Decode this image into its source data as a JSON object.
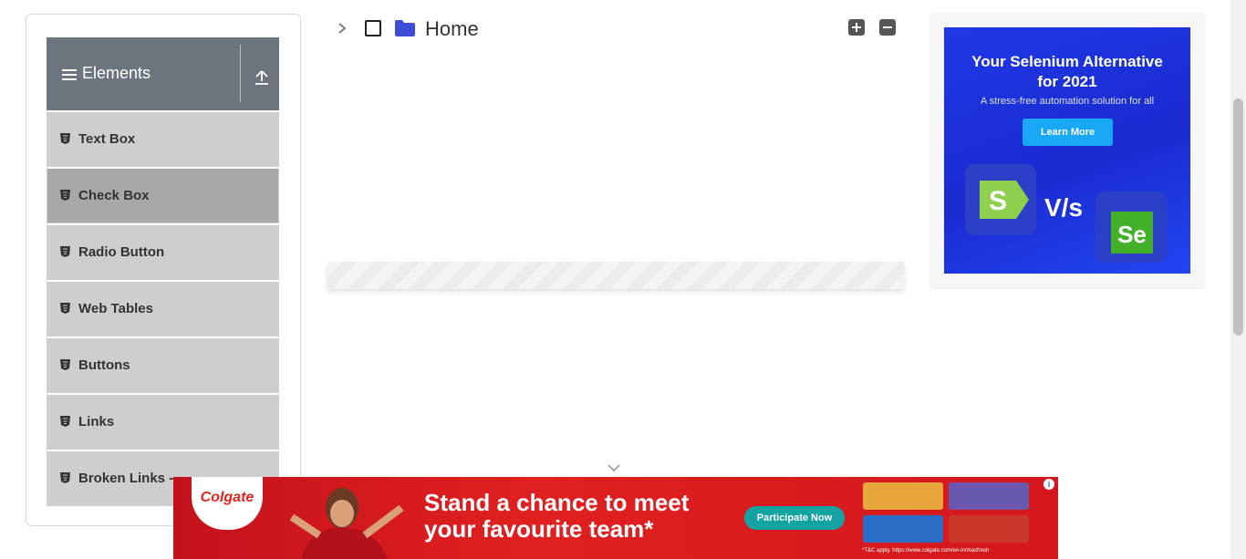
{
  "sidebar": {
    "group_title": "Elements",
    "items": [
      {
        "label": "Text Box"
      },
      {
        "label": "Check Box"
      },
      {
        "label": "Radio Button"
      },
      {
        "label": "Web Tables"
      },
      {
        "label": "Buttons"
      },
      {
        "label": "Links"
      },
      {
        "label": "Broken Links -"
      }
    ],
    "active_item": "Check Box"
  },
  "tree": {
    "root_label": "Home",
    "checked": false,
    "expanded": false
  },
  "right_ad": {
    "headline_line1": "Your Selenium Alternative",
    "headline_line2": "for 2021",
    "subtext": "A stress-free automation solution for all",
    "cta": "Learn More",
    "vs_text": "V/s",
    "logo_right": "Se",
    "logo_left": "S"
  },
  "bottom_ad": {
    "brand": "Colgate",
    "headline_line1": "Stand a chance to meet",
    "headline_line2": "your favourite team*",
    "cta": "Participate Now",
    "terms": "*T&C apply. https://www.colgate.com/en-in/maxfresh",
    "info_icon": "i"
  },
  "colors": {
    "sidebar_header": "#6c757d",
    "menu_item": "#cecece",
    "menu_item_active": "#a8a8a8",
    "folder": "#3f4cd6",
    "ad_blue": "#1f38e6",
    "colgate_red": "#d3171c"
  }
}
